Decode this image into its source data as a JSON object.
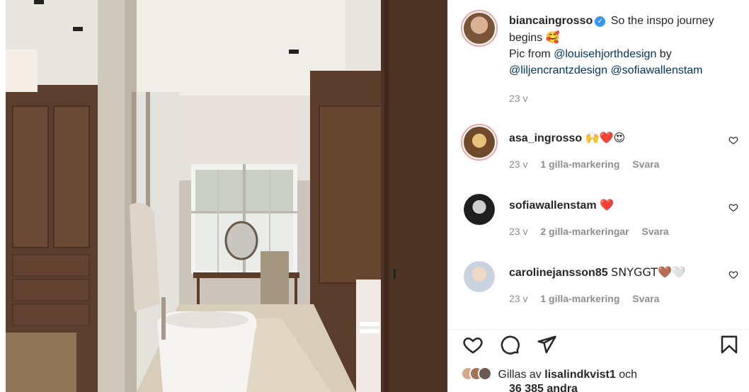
{
  "post": {
    "author": "biancaingrosso",
    "caption_text": "So the inspo journey begins",
    "caption_emoji": "🥰",
    "caption_prefix": "Pic from",
    "mention1": "@louisehjorthdesign",
    "caption_by": "by",
    "mention2": "@liljencrantzdesign",
    "mention3": "@sofiawallenstam",
    "time": "23 v",
    "verified_icon": "verified-badge-icon"
  },
  "comments": [
    {
      "user": "asa_ingrosso",
      "text": "🙌❤️😍",
      "time": "23 v",
      "likes": "1 gilla-markering",
      "reply": "Svara"
    },
    {
      "user": "sofiawallenstam",
      "text": "❤️",
      "time": "23 v",
      "likes": "2 gilla-markeringar",
      "reply": "Svara"
    },
    {
      "user": "carolinejansson85",
      "text": "SNYGGT🤎🤍",
      "time": "23 v",
      "likes": "1 gilla-markering",
      "reply": "Svara"
    }
  ],
  "liked_by": {
    "prefix": "Gillas av",
    "user": "lisalindkvist1",
    "suffix": "och",
    "others": "36 385 andra"
  },
  "icons": [
    "heart-icon",
    "comment-icon",
    "share-icon",
    "bookmark-icon",
    "small-heart-icon"
  ],
  "colors": {
    "mention": "#00376b",
    "meta": "#8e8e8e",
    "verified": "#3897f0",
    "story_ring": "#f0a3a0"
  }
}
